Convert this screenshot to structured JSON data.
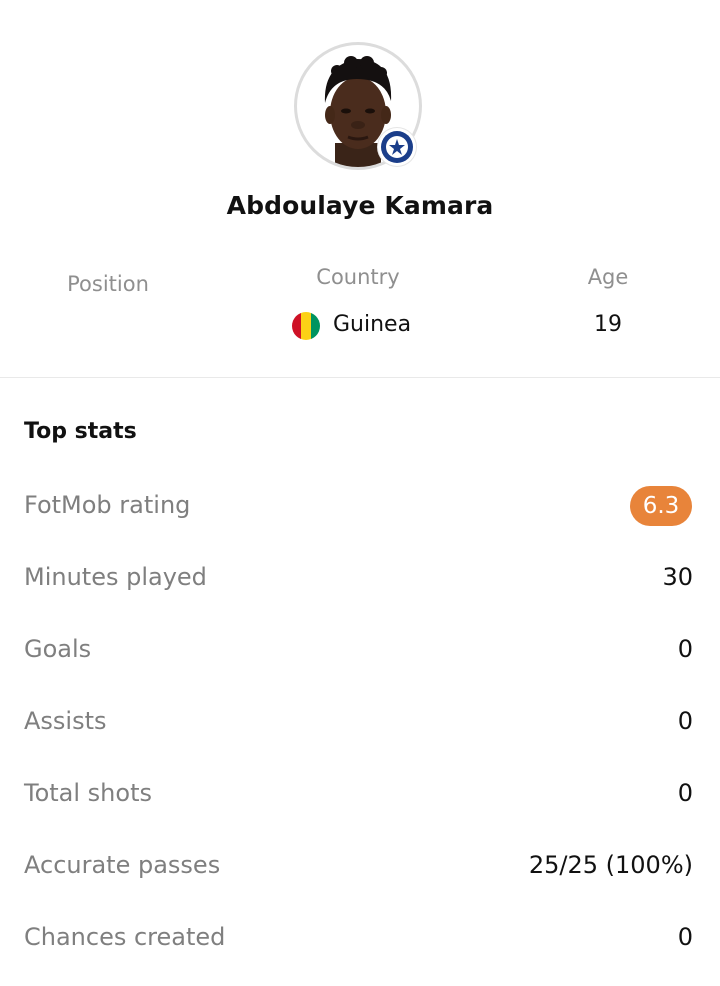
{
  "player": {
    "name": "Abdoulaye Kamara",
    "photo": "player-avatar",
    "club_badge": "portsmouth-fc-badge"
  },
  "info": {
    "position_label": "Position",
    "position_value": "",
    "country_label": "Country",
    "country_value": "Guinea",
    "country_flag_colors": [
      "#ce1126",
      "#fcd116",
      "#009460"
    ],
    "age_label": "Age",
    "age_value": "19"
  },
  "top_stats": {
    "title": "Top stats",
    "rating_color": "#e8843a",
    "rows": [
      {
        "label": "FotMob rating",
        "value": "6.3"
      },
      {
        "label": "Minutes played",
        "value": "30"
      },
      {
        "label": "Goals",
        "value": "0"
      },
      {
        "label": "Assists",
        "value": "0"
      },
      {
        "label": "Total shots",
        "value": "0"
      },
      {
        "label": "Accurate passes",
        "value": "25/25 (100%)"
      },
      {
        "label": "Chances created",
        "value": "0"
      }
    ]
  }
}
